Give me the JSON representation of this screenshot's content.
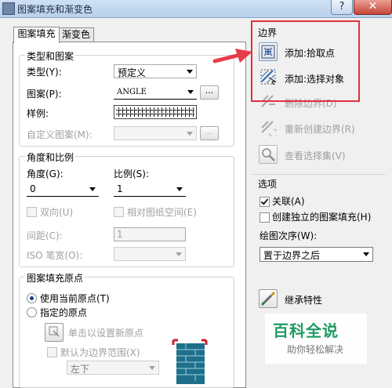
{
  "title": "图案填充和渐变色",
  "title_buttons": {
    "help": "?",
    "close": "✕"
  },
  "tabs": [
    {
      "label": "图案填充"
    },
    {
      "label": "渐变色"
    }
  ],
  "type_pattern": {
    "group_label": "类型和图案",
    "type_label": "类型(Y):",
    "type_value": "预定义",
    "pattern_label": "图案(P):",
    "pattern_value": "ANGLE",
    "pattern_button": "...",
    "swatch_label": "样例:",
    "custom_label": "自定义图案(M):",
    "custom_button": "..."
  },
  "angle_scale": {
    "group_label": "角度和比例",
    "angle_label": "角度(G):",
    "angle_value": "0",
    "scale_label": "比例(S):",
    "scale_value": "1",
    "double_label": "双向(U)",
    "relative_label": "相对图纸空间(E)",
    "spacing_label": "间距(C):",
    "spacing_value": "1",
    "iso_label": "ISO 笔宽(O):"
  },
  "origin": {
    "group_label": "图案填充原点",
    "use_current_label": "使用当前原点(T)",
    "specified_label": "指定的原点",
    "click_set_label": "单击以设置新原点",
    "default_extent_label": "默认为边界范围(X)",
    "position_value": "左下"
  },
  "boundaries": {
    "group_label": "边界",
    "add_pick_label": "添加:拾取点",
    "add_select_label": "添加:选择对象",
    "remove_label": "删除边界(D)",
    "recreate_label": "重新创建边界(R)",
    "view_label": "查看选择集(V)"
  },
  "options": {
    "group_label": "选项",
    "associative_label": "关联(A)",
    "associative_checked": true,
    "independent_label": "创建独立的图案填充(H)",
    "independent_checked": false,
    "draw_order_label": "绘图次序(W):",
    "draw_order_value": "置于边界之后"
  },
  "inherit_label": "继承特性",
  "watermark": {
    "title": "百科全说",
    "subtitle": "助你轻松解决"
  },
  "colors": {
    "highlight": "#e03039",
    "arrow": "#e83a48",
    "watermark": "#1f9a63"
  }
}
